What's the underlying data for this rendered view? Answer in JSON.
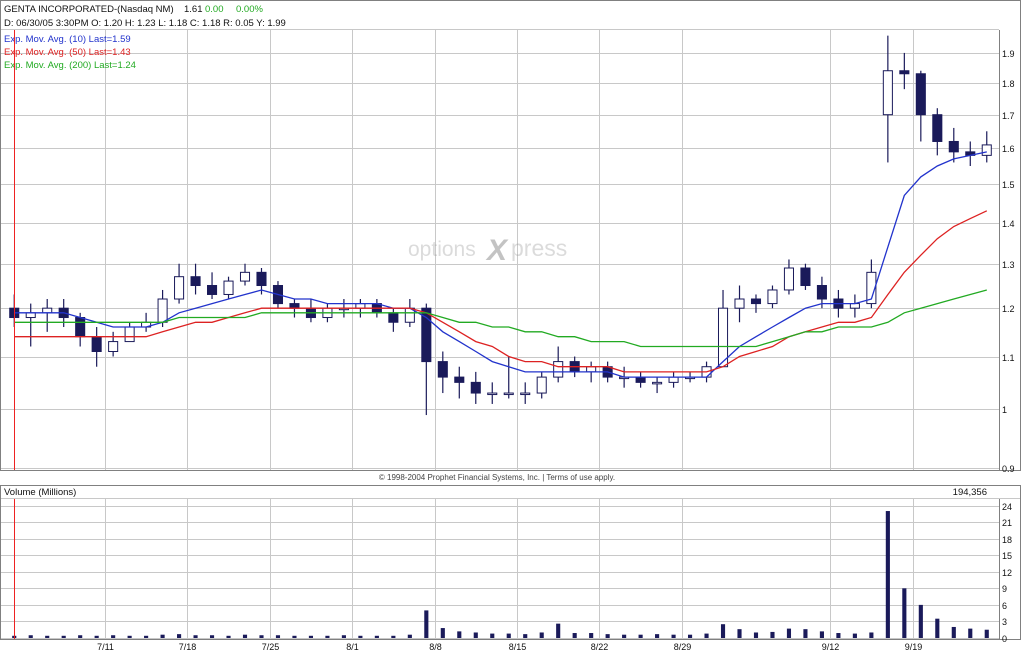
{
  "header": {
    "name": "GENTA INCORPORATED-(Nasdaq NM)",
    "last": "1.61",
    "change": "0.00",
    "change_pct": "0.00%",
    "quote_line": "D: 06/30/05 3:30PM  O: 1.20  H: 1.23  L: 1.18  C: 1.18  R: 0.05  Y: 1.99"
  },
  "legend": [
    {
      "label": "Exp. Mov. Avg. (10) Last=1.59",
      "color": "#2233cc"
    },
    {
      "label": "Exp. Mov. Avg. (50) Last=1.43",
      "color": "#dd2222"
    },
    {
      "label": "Exp. Mov. Avg. (200) Last=1.24",
      "color": "#22aa22"
    }
  ],
  "watermark": {
    "left": "options",
    "mid": "X",
    "right": "press"
  },
  "copyright": "© 1998-2004 Prophet Financial Systems, Inc.  |  Terms of use apply.",
  "volume_panel": {
    "title": "Volume (Millions)",
    "last_value": "194,356"
  },
  "colors": {
    "grid": "#c8c8c8",
    "candle": "#1a1a5a",
    "ema10": "#2233cc",
    "ema50": "#dd2222",
    "ema200": "#22aa22",
    "marker": "#ee2222",
    "volume": "#1a1a5a"
  },
  "chart_data": [
    {
      "type": "candlestick",
      "title": "GENTA INCORPORATED-(Nasdaq NM)",
      "x_tick_labels": [
        "7/11",
        "7/18",
        "7/25",
        "8/1",
        "8/8",
        "8/15",
        "8/22",
        "8/29",
        "9/12",
        "9/19"
      ],
      "x_tick_trading_day_index": [
        6,
        11,
        16,
        21,
        26,
        31,
        36,
        41,
        50,
        55
      ],
      "trading_days": 60,
      "y_scale": "log",
      "ylim": [
        0.9,
        1.98
      ],
      "y_ticks": [
        0.9,
        1,
        1.1,
        1.2,
        1.3,
        1.4,
        1.5,
        1.6,
        1.7,
        1.8,
        1.9
      ],
      "y_tick_labels": [
        "0.9",
        "1",
        "1.1",
        "1.2",
        "1.3",
        "1.4",
        "1.5",
        "1.6",
        "1.7",
        "1.8",
        "1.9"
      ],
      "ohlc": [
        [
          1.2,
          1.23,
          1.16,
          1.18
        ],
        [
          1.18,
          1.21,
          1.12,
          1.19
        ],
        [
          1.19,
          1.22,
          1.15,
          1.2
        ],
        [
          1.2,
          1.22,
          1.16,
          1.18
        ],
        [
          1.18,
          1.19,
          1.12,
          1.14
        ],
        [
          1.14,
          1.16,
          1.08,
          1.11
        ],
        [
          1.11,
          1.15,
          1.1,
          1.13
        ],
        [
          1.13,
          1.17,
          1.13,
          1.16
        ],
        [
          1.16,
          1.19,
          1.15,
          1.17
        ],
        [
          1.17,
          1.24,
          1.16,
          1.22
        ],
        [
          1.22,
          1.3,
          1.21,
          1.27
        ],
        [
          1.27,
          1.3,
          1.23,
          1.25
        ],
        [
          1.25,
          1.28,
          1.22,
          1.23
        ],
        [
          1.23,
          1.27,
          1.22,
          1.26
        ],
        [
          1.26,
          1.3,
          1.25,
          1.28
        ],
        [
          1.28,
          1.29,
          1.23,
          1.25
        ],
        [
          1.25,
          1.26,
          1.2,
          1.21
        ],
        [
          1.21,
          1.22,
          1.18,
          1.2
        ],
        [
          1.2,
          1.22,
          1.17,
          1.18
        ],
        [
          1.18,
          1.21,
          1.17,
          1.2
        ],
        [
          1.2,
          1.22,
          1.18,
          1.2
        ],
        [
          1.2,
          1.22,
          1.18,
          1.21
        ],
        [
          1.21,
          1.22,
          1.18,
          1.19
        ],
        [
          1.19,
          1.2,
          1.15,
          1.17
        ],
        [
          1.17,
          1.22,
          1.16,
          1.2
        ],
        [
          1.2,
          1.21,
          0.99,
          1.09
        ],
        [
          1.09,
          1.11,
          1.03,
          1.06
        ],
        [
          1.06,
          1.08,
          1.02,
          1.05
        ],
        [
          1.05,
          1.07,
          1.01,
          1.03
        ],
        [
          1.03,
          1.05,
          1.01,
          1.03
        ],
        [
          1.03,
          1.1,
          1.02,
          1.03
        ],
        [
          1.03,
          1.05,
          1.01,
          1.03
        ],
        [
          1.03,
          1.07,
          1.02,
          1.06
        ],
        [
          1.06,
          1.12,
          1.05,
          1.09
        ],
        [
          1.09,
          1.1,
          1.06,
          1.07
        ],
        [
          1.07,
          1.09,
          1.05,
          1.08
        ],
        [
          1.08,
          1.09,
          1.05,
          1.06
        ],
        [
          1.06,
          1.08,
          1.04,
          1.06
        ],
        [
          1.06,
          1.07,
          1.04,
          1.05
        ],
        [
          1.05,
          1.06,
          1.03,
          1.05
        ],
        [
          1.05,
          1.07,
          1.04,
          1.06
        ],
        [
          1.06,
          1.07,
          1.05,
          1.06
        ],
        [
          1.06,
          1.09,
          1.05,
          1.08
        ],
        [
          1.08,
          1.24,
          1.08,
          1.2
        ],
        [
          1.2,
          1.25,
          1.17,
          1.22
        ],
        [
          1.22,
          1.23,
          1.19,
          1.21
        ],
        [
          1.21,
          1.25,
          1.2,
          1.24
        ],
        [
          1.24,
          1.31,
          1.23,
          1.29
        ],
        [
          1.29,
          1.3,
          1.24,
          1.25
        ],
        [
          1.25,
          1.27,
          1.2,
          1.22
        ],
        [
          1.22,
          1.24,
          1.18,
          1.2
        ],
        [
          1.2,
          1.23,
          1.18,
          1.21
        ],
        [
          1.21,
          1.31,
          1.2,
          1.28
        ],
        [
          1.7,
          1.96,
          1.56,
          1.84
        ],
        [
          1.84,
          1.9,
          1.78,
          1.83
        ],
        [
          1.83,
          1.84,
          1.62,
          1.7
        ],
        [
          1.7,
          1.72,
          1.58,
          1.62
        ],
        [
          1.62,
          1.66,
          1.56,
          1.59
        ],
        [
          1.59,
          1.62,
          1.55,
          1.58
        ],
        [
          1.58,
          1.65,
          1.56,
          1.61
        ]
      ],
      "series": [
        {
          "name": "Exp. Mov. Avg. (10)",
          "values": [
            1.19,
            1.19,
            1.19,
            1.19,
            1.18,
            1.17,
            1.16,
            1.16,
            1.16,
            1.17,
            1.19,
            1.2,
            1.21,
            1.22,
            1.23,
            1.24,
            1.23,
            1.22,
            1.22,
            1.21,
            1.21,
            1.21,
            1.21,
            1.2,
            1.2,
            1.18,
            1.15,
            1.13,
            1.11,
            1.09,
            1.08,
            1.07,
            1.07,
            1.07,
            1.07,
            1.07,
            1.07,
            1.06,
            1.06,
            1.06,
            1.06,
            1.06,
            1.06,
            1.09,
            1.12,
            1.14,
            1.16,
            1.18,
            1.2,
            1.21,
            1.21,
            1.21,
            1.22,
            1.34,
            1.47,
            1.52,
            1.55,
            1.57,
            1.58,
            1.59
          ]
        },
        {
          "name": "Exp. Mov. Avg. (50)",
          "values": [
            1.14,
            1.14,
            1.14,
            1.14,
            1.14,
            1.14,
            1.14,
            1.14,
            1.14,
            1.15,
            1.16,
            1.17,
            1.17,
            1.18,
            1.19,
            1.2,
            1.2,
            1.2,
            1.2,
            1.2,
            1.2,
            1.2,
            1.2,
            1.2,
            1.2,
            1.19,
            1.17,
            1.15,
            1.13,
            1.12,
            1.1,
            1.09,
            1.09,
            1.08,
            1.08,
            1.08,
            1.08,
            1.07,
            1.07,
            1.07,
            1.07,
            1.07,
            1.07,
            1.08,
            1.1,
            1.11,
            1.12,
            1.14,
            1.15,
            1.16,
            1.17,
            1.17,
            1.18,
            1.23,
            1.28,
            1.32,
            1.36,
            1.39,
            1.41,
            1.43
          ]
        },
        {
          "name": "Exp. Mov. Avg. (200)",
          "values": [
            1.17,
            1.17,
            1.17,
            1.17,
            1.17,
            1.17,
            1.17,
            1.17,
            1.17,
            1.17,
            1.18,
            1.18,
            1.18,
            1.18,
            1.18,
            1.19,
            1.19,
            1.19,
            1.19,
            1.19,
            1.19,
            1.19,
            1.19,
            1.19,
            1.19,
            1.19,
            1.18,
            1.17,
            1.17,
            1.16,
            1.16,
            1.15,
            1.15,
            1.14,
            1.14,
            1.13,
            1.13,
            1.13,
            1.12,
            1.12,
            1.12,
            1.12,
            1.12,
            1.12,
            1.12,
            1.12,
            1.13,
            1.14,
            1.15,
            1.15,
            1.16,
            1.16,
            1.16,
            1.17,
            1.19,
            1.2,
            1.21,
            1.22,
            1.23,
            1.24
          ]
        }
      ]
    },
    {
      "type": "bar",
      "title": "Volume (Millions)",
      "ylim": [
        0,
        25
      ],
      "y_ticks": [
        0,
        3,
        6,
        9,
        12,
        15,
        18,
        21,
        24
      ],
      "y_tick_labels": [
        "0",
        "3",
        "6",
        "9",
        "12",
        "15",
        "18",
        "21",
        "24"
      ],
      "values": [
        0.4,
        0.5,
        0.4,
        0.4,
        0.5,
        0.4,
        0.5,
        0.4,
        0.4,
        0.6,
        0.7,
        0.5,
        0.5,
        0.4,
        0.6,
        0.5,
        0.5,
        0.4,
        0.4,
        0.4,
        0.5,
        0.4,
        0.4,
        0.4,
        0.6,
        5.0,
        1.8,
        1.2,
        1.0,
        0.8,
        0.8,
        0.7,
        1.0,
        2.6,
        0.9,
        0.9,
        0.7,
        0.6,
        0.6,
        0.7,
        0.6,
        0.6,
        0.8,
        2.5,
        1.6,
        1.0,
        1.1,
        1.7,
        1.6,
        1.2,
        0.9,
        0.8,
        1.0,
        23.0,
        9.0,
        6.0,
        3.5,
        2.0,
        1.7,
        1.5
      ]
    }
  ]
}
